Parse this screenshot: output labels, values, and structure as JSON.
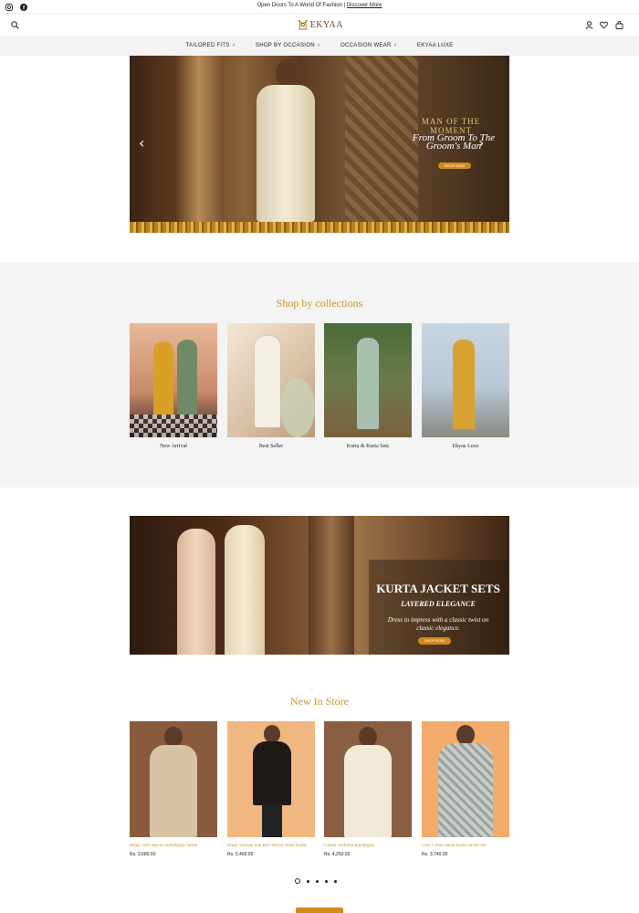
{
  "announcement": {
    "text": "Open Doors To A World Of Fashion |",
    "link": "Discover More"
  },
  "social": [
    {
      "icon": "instagram-icon"
    },
    {
      "icon": "facebook-icon"
    }
  ],
  "brand": {
    "name": "EKYAA",
    "color": "#6b4a2a"
  },
  "nav": {
    "items": [
      {
        "label": "TAILORED FITS",
        "caret": "˅"
      },
      {
        "label": "SHOP BY OCCASION",
        "caret": "˅"
      },
      {
        "label": "OCCASION WEAR",
        "caret": "˅"
      },
      {
        "label": "EKYAA LUXE",
        "caret": ""
      }
    ]
  },
  "hero": {
    "title": "MAN OF THE MOMENT",
    "subtitle": "From Groom To The Groom's Man",
    "button": "SHOP NOW",
    "prev": "‹",
    "next": "›"
  },
  "collections": {
    "title": "Shop by collections",
    "items": [
      {
        "label": "New Arrival"
      },
      {
        "label": "Best Seller"
      },
      {
        "label": "Kurta & Kurta Sets"
      },
      {
        "label": "Ekyaa Luxe"
      }
    ]
  },
  "promo": {
    "title": "KURTA JACKET SETS",
    "subtitle": "LAYERED ELEGANCE",
    "description": "Dress to impress with a classic twist on classic elegance.",
    "button": "SHOP NOW"
  },
  "new_in_store": {
    "title": "New In Store",
    "products": [
      {
        "name": "Beige Terry Rayon Bandhgala Jacket",
        "price": "Rs. 3,680.00"
      },
      {
        "name": "Black Viscose Silk Red Mirror Work Kurta",
        "price": "Rs. 2,469.00"
      },
      {
        "name": "Cream Textured Bandhgala",
        "price": "Rs. 4,260.00"
      },
      {
        "name": "Grey Cotton Ikkat Kurta Jacket Set",
        "price": "Rs. 3,740.00"
      }
    ]
  },
  "colors": {
    "accent": "#c99522",
    "button": "#d28a1e",
    "section_bg": "#f4f4f4"
  }
}
